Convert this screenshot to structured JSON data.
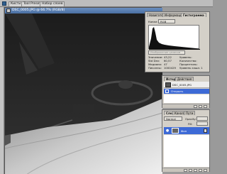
{
  "topbar": {
    "tabs": [
      "Кисти",
      "Tool Presets",
      "Набор слоев"
    ]
  },
  "document": {
    "title": "DSC_0005.JPG @ 66.7% (RGB/8)"
  },
  "histogram": {
    "tabs": [
      "Навигатор",
      "Информация",
      "Гистограмма"
    ],
    "channel_label": "Канал:",
    "channel_value": "RGB",
    "source_value": "Изображение целиком",
    "stats_left": [
      {
        "label": "Значение:",
        "value": "43,22"
      },
      {
        "label": "Std Dev:",
        "value": "60,57"
      },
      {
        "label": "Медиана:",
        "value": "47"
      },
      {
        "label": "Пикселы:",
        "value": "1000429"
      }
    ],
    "stats_right": [
      {
        "label": "Уровень:",
        "value": ""
      },
      {
        "label": "Количество:",
        "value": ""
      },
      {
        "label": "Процентиль:",
        "value": ""
      },
      {
        "label": "Кэш:",
        "value": ""
      }
    ],
    "cache_level_label": "Уровень кэша: 1"
  },
  "history": {
    "tabs": [
      "История",
      "Действия"
    ],
    "snapshot_label": "DSC_0005.JPG",
    "items": [
      "Открыть"
    ]
  },
  "layers": {
    "tabs": [
      "Слои",
      "Каналы",
      "Пути"
    ],
    "blend_mode": "Normal",
    "opacity_label": "Opacity:",
    "fill_label": "Fill:",
    "layer_name": "Фон"
  },
  "colors": {
    "title_active": "#4a6fa2",
    "selection": "#3d6ad6",
    "panel_bg": "#d4d0c8"
  }
}
